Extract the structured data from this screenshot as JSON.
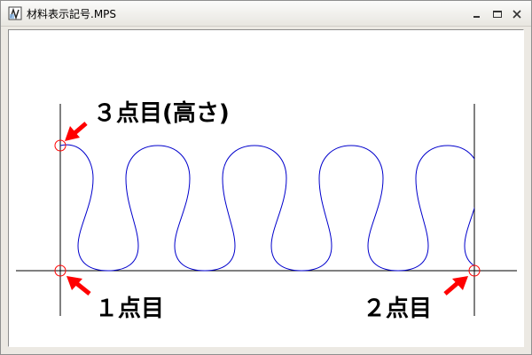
{
  "window": {
    "title": "材料表示記号.MPS",
    "icon": "material-symbol-app-icon",
    "controls": {
      "minimize": "minimize-icon",
      "maximize": "maximize-icon",
      "close": "close-icon"
    }
  },
  "drawing": {
    "annotations": {
      "point3": "３点目(高さ)",
      "point1": "１点目",
      "point2": "２点目"
    },
    "colors": {
      "wave": "#0000cc",
      "marker": "#ff0000",
      "arrow": "#ff0000",
      "line": "#000000",
      "background": "#ffffff"
    }
  }
}
